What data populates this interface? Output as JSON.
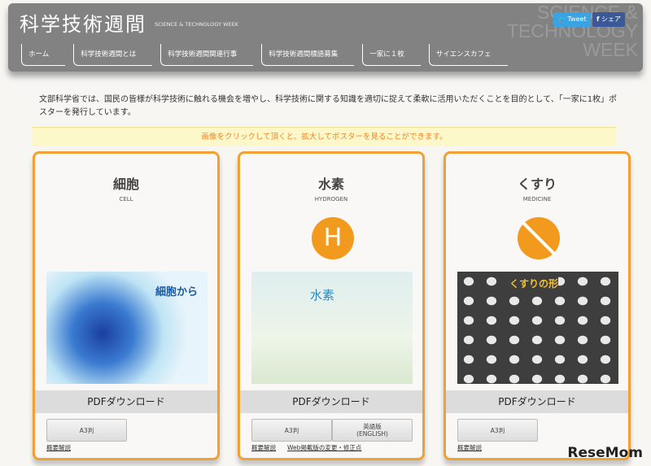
{
  "header": {
    "logo": "科学技術週間",
    "logo_sub": "SCIENCE & TECHNOLOGY WEEK",
    "bg_text": [
      "SCIENCE &",
      "TECHNOLOGY",
      "WEEK"
    ],
    "tweet": "Tweet",
    "share": "シェア",
    "nav": [
      "ホーム",
      "科学技術週間とは",
      "科学技術週間関連行事",
      "科学技術週間標語募集",
      "一家に１枚",
      "サイエンスカフェ"
    ]
  },
  "intro": "文部科学省では、国民の皆様が科学技術に触れる機会を増やし、科学技術に関する知識を適切に捉えて柔軟に活用いただくことを目的として、「一家に1枚」ポスターを発行しています。",
  "banner": "画像をクリックして頂くと、拡大してポスターを見ることができます。",
  "cards": [
    {
      "title": "細胞",
      "sub": "CELL",
      "poster_text": "細胞から",
      "pdf": "PDFダウンロード",
      "btn1": "A3判",
      "link1": "概要解説"
    },
    {
      "title": "水素",
      "sub": "HYDROGEN",
      "badge": "H",
      "poster_text": "水素",
      "pdf": "PDFダウンロード",
      "btn1": "A3判",
      "btn2": "英語版\n(ENGLISH)",
      "link1": "概要解説",
      "link2": "Web掲載版の変更・修正点"
    },
    {
      "title": "くすり",
      "sub": "MEDICINE",
      "poster_text": "くすりの形",
      "pdf": "PDFダウンロード",
      "btn1": "A3判",
      "link1": "概要解説"
    }
  ],
  "watermark": "ReseMom",
  "colors": {
    "accent": "#f2a033",
    "header": "#828282"
  }
}
